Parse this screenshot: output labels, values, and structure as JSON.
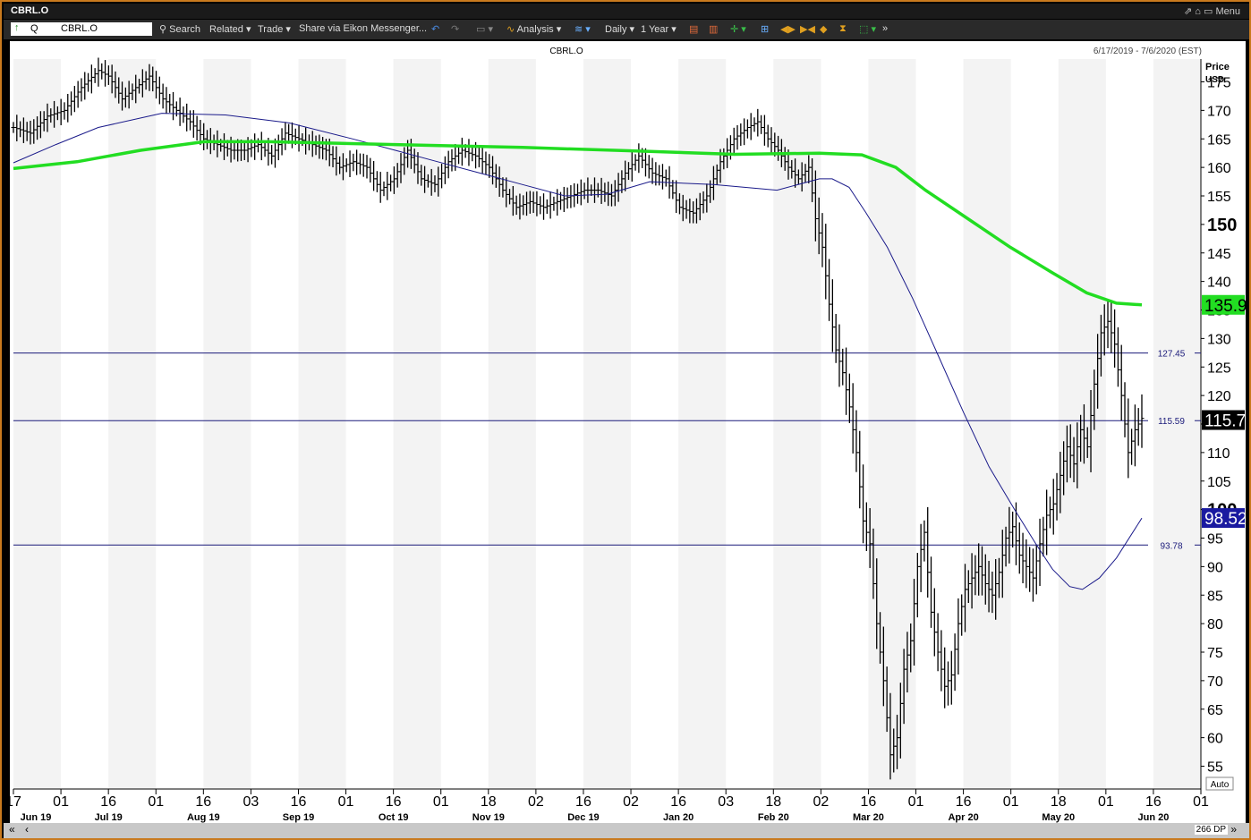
{
  "window": {
    "title": "CBRL.O",
    "menu_label": "Menu"
  },
  "toolbar": {
    "ric": "CBRL.O",
    "quote_label": "Q",
    "search": "Search",
    "related": "Related",
    "trade": "Trade",
    "share": "Share via Eikon Messenger...",
    "analysis": "Analysis",
    "interval": "Daily",
    "period": "1 Year"
  },
  "chart_data": {
    "type": "ohlc",
    "title": "CBRL.O",
    "date_range": "6/17/2019 - 7/6/2020 (EST)",
    "axis_title": "Price",
    "axis_unit": "USD",
    "ylim": [
      51,
      179
    ],
    "yticks": [
      55,
      60,
      65,
      70,
      75,
      80,
      85,
      90,
      95,
      100,
      105,
      110,
      115,
      120,
      125,
      130,
      135,
      140,
      145,
      150,
      155,
      160,
      165,
      170,
      175
    ],
    "days": 266,
    "x_ticks_top": [
      "17",
      "01",
      "16",
      "01",
      "16",
      "03",
      "16",
      "01",
      "16",
      "01",
      "18",
      "02",
      "16",
      "02",
      "16",
      "03",
      "18",
      "02",
      "16",
      "01",
      "16",
      "01",
      "18",
      "01",
      "16",
      "01"
    ],
    "x_ticks_bottom": [
      "Jun 19",
      "Jul 19",
      "Aug 19",
      "Sep 19",
      "Oct 19",
      "Nov 19",
      "Dec 19",
      "Jan 20",
      "Feb 20",
      "Mar 20",
      "Apr 20",
      "May 20",
      "Jun 20"
    ],
    "horizontal_lines": [
      {
        "value": 127.45,
        "label": "127.45"
      },
      {
        "value": 115.59,
        "label": "115.59"
      },
      {
        "value": 93.78,
        "label": "93.78"
      }
    ],
    "last_price": {
      "value": 115.7,
      "label": "115.7"
    },
    "ma_long": {
      "last": 135.9,
      "label": "135.9",
      "color": "#22dd22",
      "points": [
        [
          0,
          159.8
        ],
        [
          15,
          161
        ],
        [
          30,
          163
        ],
        [
          45,
          164.5
        ],
        [
          60,
          164.5
        ],
        [
          90,
          164
        ],
        [
          120,
          163.5
        ],
        [
          150,
          162.8
        ],
        [
          170,
          162.3
        ],
        [
          190,
          162.5
        ],
        [
          200,
          162.2
        ],
        [
          208,
          160
        ],
        [
          215,
          156
        ],
        [
          225,
          151
        ],
        [
          235,
          146
        ],
        [
          245,
          141.5
        ],
        [
          253,
          138
        ],
        [
          260,
          136.2
        ],
        [
          266,
          135.9
        ]
      ]
    },
    "ma_short": {
      "last": 98.52,
      "label": "98.52",
      "color": "#1a1a8a",
      "points": [
        [
          0,
          160.8
        ],
        [
          10,
          164
        ],
        [
          20,
          167
        ],
        [
          35,
          169.5
        ],
        [
          50,
          169.2
        ],
        [
          65,
          167.8
        ],
        [
          80,
          165
        ],
        [
          90,
          163
        ],
        [
          100,
          161
        ],
        [
          110,
          159
        ],
        [
          120,
          157
        ],
        [
          130,
          155
        ],
        [
          140,
          155.3
        ],
        [
          150,
          157.5
        ],
        [
          165,
          157
        ],
        [
          180,
          156
        ],
        [
          190,
          158
        ],
        [
          193,
          158
        ],
        [
          197,
          156.5
        ],
        [
          201,
          152
        ],
        [
          206,
          146
        ],
        [
          212,
          137
        ],
        [
          218,
          127
        ],
        [
          224,
          117
        ],
        [
          230,
          107.5
        ],
        [
          236,
          100
        ],
        [
          241,
          94
        ],
        [
          245,
          89.5
        ],
        [
          249,
          86.5
        ],
        [
          252,
          86
        ],
        [
          256,
          88
        ],
        [
          260,
          91.5
        ],
        [
          266,
          98.5
        ]
      ]
    },
    "price_series": [
      [
        0,
        167
      ],
      [
        5,
        166
      ],
      [
        10,
        169
      ],
      [
        15,
        170
      ],
      [
        20,
        174
      ],
      [
        25,
        177
      ],
      [
        28,
        176
      ],
      [
        32,
        172
      ],
      [
        36,
        174
      ],
      [
        40,
        176
      ],
      [
        44,
        172
      ],
      [
        48,
        170
      ],
      [
        52,
        168
      ],
      [
        56,
        165
      ],
      [
        60,
        164
      ],
      [
        64,
        163
      ],
      [
        68,
        163
      ],
      [
        72,
        164
      ],
      [
        76,
        162
      ],
      [
        80,
        166
      ],
      [
        84,
        165
      ],
      [
        88,
        164
      ],
      [
        92,
        163
      ],
      [
        96,
        160
      ],
      [
        100,
        161
      ],
      [
        104,
        160
      ],
      [
        108,
        156
      ],
      [
        112,
        158
      ],
      [
        116,
        163
      ],
      [
        120,
        158
      ],
      [
        124,
        157
      ],
      [
        128,
        161
      ],
      [
        132,
        163
      ],
      [
        136,
        162
      ],
      [
        140,
        160
      ],
      [
        144,
        156
      ],
      [
        148,
        153
      ],
      [
        152,
        154
      ],
      [
        156,
        153
      ],
      [
        160,
        154
      ],
      [
        164,
        155
      ],
      [
        168,
        156
      ],
      [
        172,
        156
      ],
      [
        176,
        155
      ],
      [
        180,
        159
      ],
      [
        184,
        162
      ],
      [
        188,
        159
      ],
      [
        192,
        158
      ],
      [
        196,
        153
      ],
      [
        200,
        152
      ],
      [
        204,
        155
      ],
      [
        208,
        161
      ],
      [
        212,
        165
      ],
      [
        216,
        167
      ],
      [
        219,
        168
      ],
      [
        222,
        165
      ],
      [
        225,
        163
      ],
      [
        228,
        160
      ],
      [
        231,
        158
      ],
      [
        234,
        160
      ],
      [
        236,
        151
      ],
      [
        238,
        146
      ],
      [
        240,
        136
      ],
      [
        242,
        128
      ],
      [
        244,
        124
      ],
      [
        246,
        118
      ],
      [
        248,
        110
      ],
      [
        250,
        98
      ],
      [
        252,
        94
      ],
      [
        254,
        80
      ],
      [
        256,
        70
      ],
      [
        258,
        57
      ],
      [
        260,
        60
      ],
      [
        262,
        72
      ],
      [
        264,
        77
      ],
      [
        266,
        90
      ],
      [
        268,
        96
      ],
      [
        270,
        82
      ],
      [
        272,
        75
      ],
      [
        274,
        69
      ],
      [
        276,
        71
      ],
      [
        278,
        80
      ],
      [
        280,
        86
      ],
      [
        282,
        88
      ],
      [
        284,
        90
      ],
      [
        286,
        87
      ],
      [
        288,
        85
      ],
      [
        290,
        89
      ],
      [
        292,
        95
      ],
      [
        294,
        97
      ],
      [
        296,
        92
      ],
      [
        298,
        90
      ],
      [
        300,
        88
      ],
      [
        302,
        94
      ],
      [
        304,
        99
      ],
      [
        306,
        101
      ],
      [
        308,
        106
      ],
      [
        310,
        111
      ],
      [
        312,
        108
      ],
      [
        314,
        114
      ],
      [
        316,
        111
      ],
      [
        318,
        122
      ],
      [
        320,
        131
      ],
      [
        322,
        133
      ],
      [
        324,
        129
      ],
      [
        326,
        120
      ],
      [
        328,
        110
      ],
      [
        330,
        114
      ],
      [
        332,
        116
      ]
    ]
  }
}
